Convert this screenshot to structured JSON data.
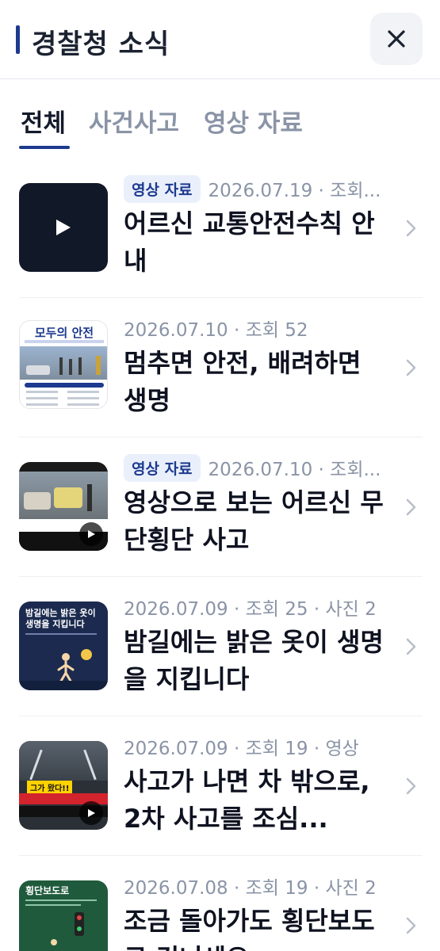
{
  "header": {
    "title": "경찰청 소식",
    "close_icon": "close-icon"
  },
  "tabs": [
    {
      "label": "전체",
      "active": true
    },
    {
      "label": "사건사고",
      "active": false
    },
    {
      "label": "영상 자료",
      "active": false
    }
  ],
  "items": [
    {
      "badge": "영상 자료",
      "meta": "2026.07.19 · 조회...",
      "title": "어르신 교통안전수칙 안내",
      "thumb": "video-play-thumbnail"
    },
    {
      "badge": "",
      "meta": "2026.07.10 · 조회 52",
      "title": "멈추면 안전, 배려하면 생명",
      "thumb": "poster-thumbnail",
      "thumb_text": "모두의 안전"
    },
    {
      "badge": "영상 자료",
      "meta": "2026.07.10 · 조회...",
      "title": "영상으로 보는 어르신 무단횡단 사고",
      "thumb": "street-video-thumbnail"
    },
    {
      "badge": "",
      "meta": "2026.07.09 · 조회 25 · 사진 2",
      "title": "밤길에는 밝은 옷이 생명을 지킵니다",
      "thumb": "night-poster-thumbnail",
      "thumb_text": "밤길에는 밝은 옷이 생명을 지킵니다"
    },
    {
      "badge": "",
      "meta": "2026.07.09 · 조회 19 · 영상",
      "title": "사고가 나면 차 밖으로, 2차 사고를 조심...",
      "thumb": "highway-video-thumbnail",
      "thumb_text": "그가 왔다!!"
    },
    {
      "badge": "",
      "meta": "2026.07.08 · 조회 19 · 사진 2",
      "title": "조금 돌아가도 횡단보도로 건너세요",
      "thumb": "crosswalk-poster-thumbnail",
      "thumb_text": "횡단보도로"
    }
  ],
  "colors": {
    "accent": "#1d3a8f",
    "muted": "#8a94a6",
    "title": "#0e1220",
    "badge_bg": "#eaf0fb"
  }
}
